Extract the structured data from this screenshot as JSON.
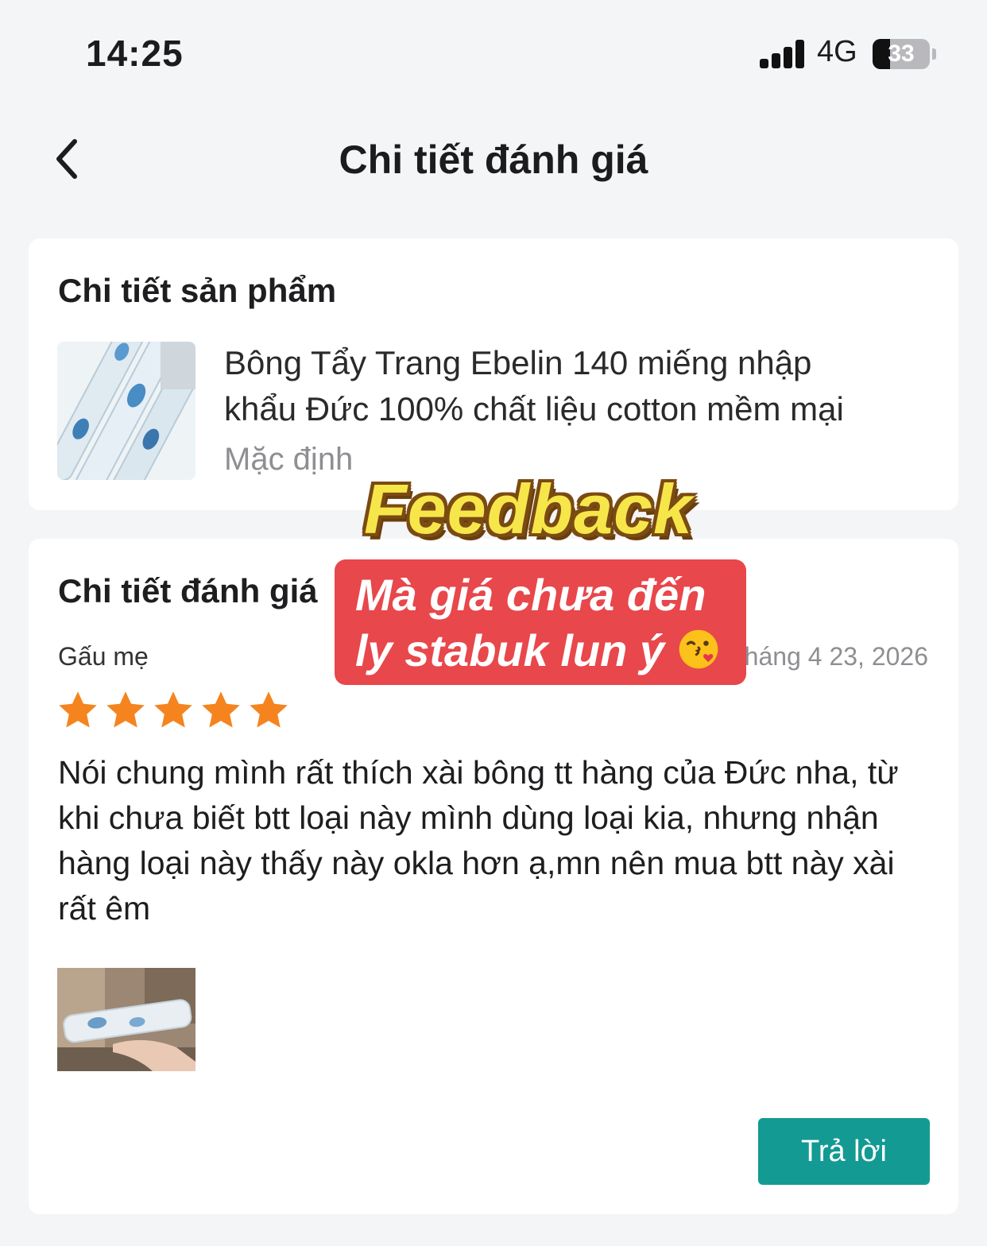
{
  "status_bar": {
    "time": "14:25",
    "network": "4G",
    "battery_level": "33"
  },
  "nav": {
    "back_icon": "chevron-left-icon",
    "title": "Chi tiết đánh giá"
  },
  "product_card": {
    "heading": "Chi tiết sản phẩm",
    "name_line1": "Bông Tẩy Trang Ebelin 140 miếng nhập",
    "name_line2": "khẩu Đức 100% chất liệu cotton mềm mại",
    "variant": "Mặc định"
  },
  "review_card": {
    "heading": "Chi tiết đánh giá",
    "reviewer": "Gấu mẹ",
    "date": "Tháng 4 23, 2026",
    "rating": 5,
    "rating_max": 5,
    "text": "Nói chung mình rất thích xài bông tt hàng của Đức nha, từ khi chưa biết btt loại này mình dùng loại kia, nhưng nhận hàng loại này thấy này okla hơn ạ,mn nên mua btt này xài rất êm",
    "reply_label": "Trả lời"
  },
  "overlay": {
    "sticker_word": "Feedback",
    "caption_line1": "Mà giá chưa đến",
    "caption_line2": "ly stabuk lun ý",
    "caption_emoji": "kissing-face-emoji"
  },
  "colors": {
    "star": "#f5841f",
    "reply_button": "#139a93",
    "caption_bg": "#e8474b",
    "sticker_text": "#f7e64a"
  }
}
